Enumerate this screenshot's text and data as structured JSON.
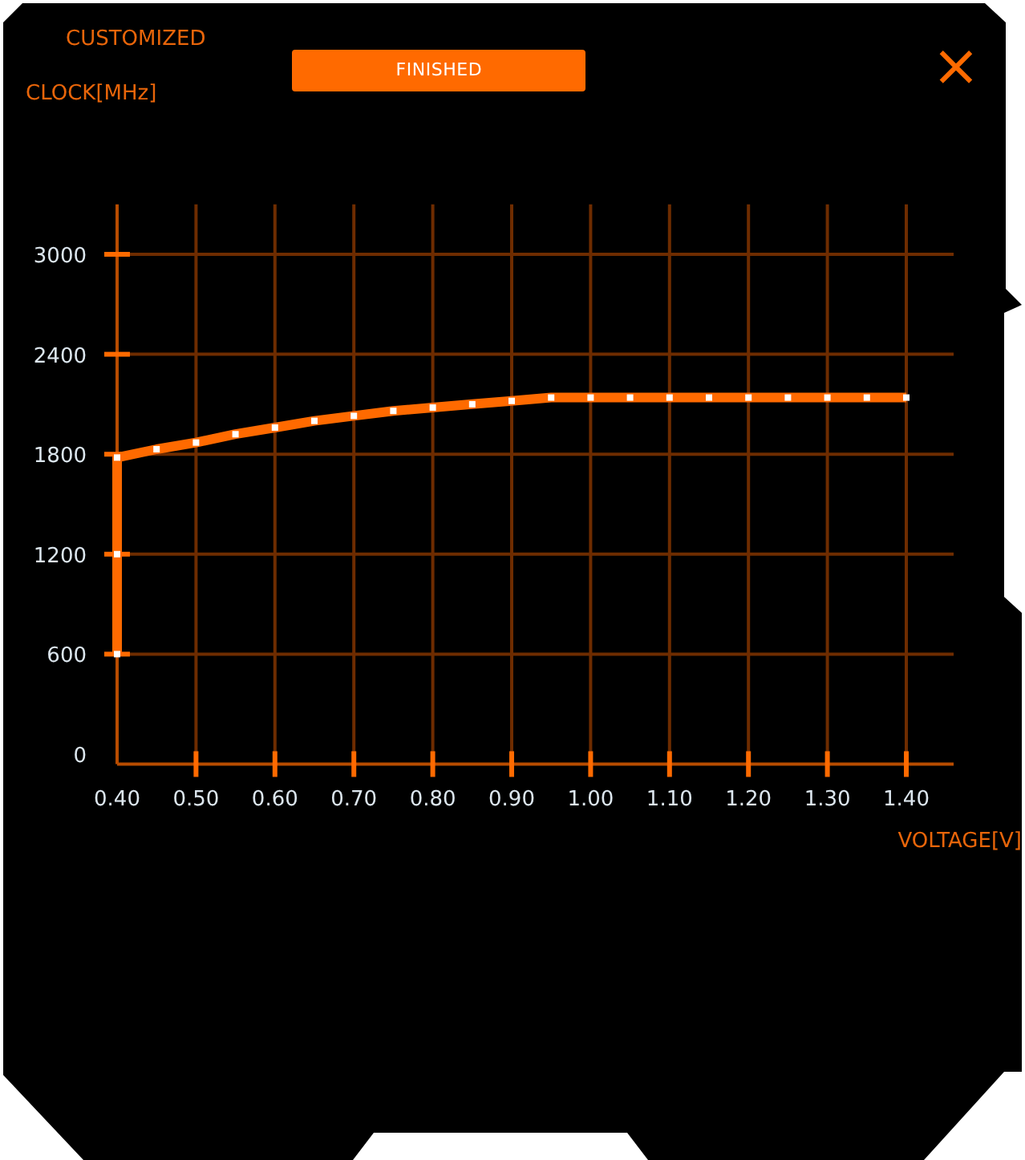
{
  "header": {
    "title": "CUSTOMIZED",
    "button": "FINISHED",
    "close": "×"
  },
  "chart": {
    "chart_data": {
      "type": "line",
      "ylabel": "CLOCK[MHz]",
      "xlabel": "VOLTAGE[V]",
      "xlim": [
        0.4,
        1.46
      ],
      "ylim": [
        -60,
        3300
      ],
      "grid": true,
      "xticks": [
        {
          "value": 0.4,
          "label": "0.40"
        },
        {
          "value": 0.5,
          "label": "0.50"
        },
        {
          "value": 0.6,
          "label": "0.60"
        },
        {
          "value": 0.7,
          "label": "0.70"
        },
        {
          "value": 0.8,
          "label": "0.80"
        },
        {
          "value": 0.9,
          "label": "0.90"
        },
        {
          "value": 1.0,
          "label": "1.00"
        },
        {
          "value": 1.1,
          "label": "1.10"
        },
        {
          "value": 1.2,
          "label": "1.20"
        },
        {
          "value": 1.3,
          "label": "1.30"
        },
        {
          "value": 1.4,
          "label": "1.40"
        }
      ],
      "yticks": [
        0,
        600,
        1200,
        1800,
        2400,
        3000
      ],
      "x": [
        0.4,
        0.4,
        0.4,
        0.45,
        0.5,
        0.55,
        0.6,
        0.65,
        0.7,
        0.75,
        0.8,
        0.85,
        0.9,
        0.95,
        1.0,
        1.05,
        1.1,
        1.15,
        1.2,
        1.25,
        1.3,
        1.35,
        1.4
      ],
      "series": [
        {
          "color": "#ff6a00",
          "marker": "square",
          "values": [
            600,
            1200,
            1780,
            1830,
            1870,
            1920,
            1960,
            2000,
            2030,
            2060,
            2080,
            2100,
            2120,
            2140,
            2140,
            2140,
            2140,
            2140,
            2140,
            2140,
            2140,
            2140,
            2140
          ]
        }
      ]
    }
  }
}
